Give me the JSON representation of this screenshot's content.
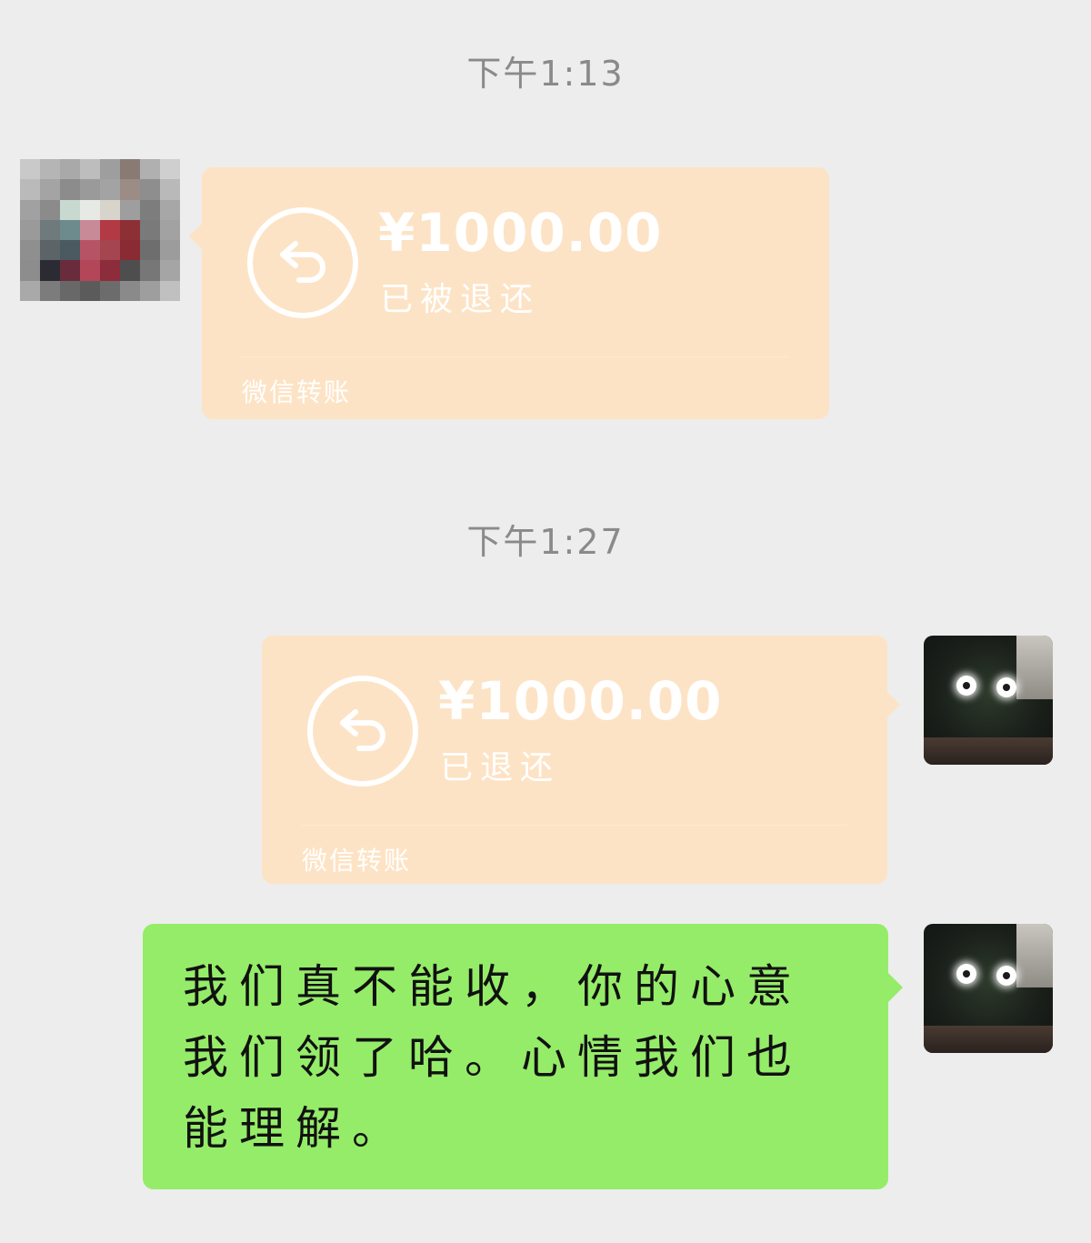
{
  "chat": {
    "timestamps": [
      "下午1:13",
      "下午1:27"
    ],
    "messages": [
      {
        "side": "left",
        "type": "transfer",
        "amount": "¥1000.00",
        "status": "已被退还",
        "footer": "微信转账",
        "icon": "return-arrow-icon"
      },
      {
        "side": "right",
        "type": "transfer",
        "amount": "¥1000.00",
        "status": "已退还",
        "footer": "微信转账",
        "icon": "return-arrow-icon"
      },
      {
        "side": "right",
        "type": "text",
        "text": "我们真不能收，你的心意我们领了哈。心情我们也能理解。"
      }
    ]
  },
  "colors": {
    "background": "#ededed",
    "transfer_bubble": "#fde3c5",
    "self_text_bubble": "#95ec69",
    "timestamp_text": "#8a8a8a"
  }
}
